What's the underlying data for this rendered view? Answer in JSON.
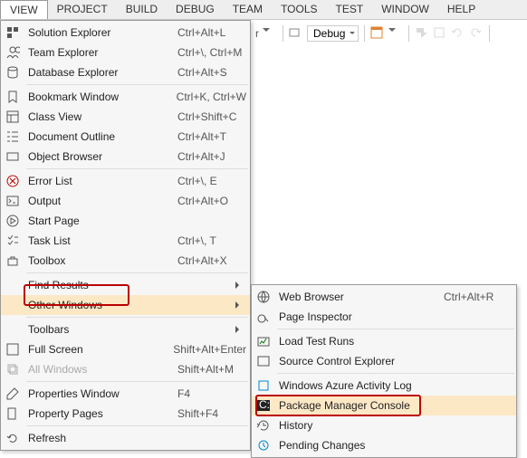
{
  "menubar": [
    "VIEW",
    "PROJECT",
    "BUILD",
    "DEBUG",
    "TEAM",
    "TOOLS",
    "TEST",
    "WINDOW",
    "HELP"
  ],
  "toolbar": {
    "suffix": "r",
    "config": "Debug"
  },
  "view_menu": [
    {
      "icon": "solution",
      "label": "Solution Explorer",
      "sc": "Ctrl+Alt+L"
    },
    {
      "icon": "team",
      "label": "Team Explorer",
      "sc": "Ctrl+\\, Ctrl+M"
    },
    {
      "icon": "db",
      "label": "Database Explorer",
      "sc": "Ctrl+Alt+S"
    },
    {
      "sep": true
    },
    {
      "icon": "bookmark",
      "label": "Bookmark Window",
      "sc": "Ctrl+K, Ctrl+W"
    },
    {
      "icon": "class",
      "label": "Class View",
      "sc": "Ctrl+Shift+C"
    },
    {
      "icon": "outline",
      "label": "Document Outline",
      "sc": "Ctrl+Alt+T"
    },
    {
      "icon": "object",
      "label": "Object Browser",
      "sc": "Ctrl+Alt+J"
    },
    {
      "sep": true
    },
    {
      "icon": "error",
      "label": "Error List",
      "sc": "Ctrl+\\, E"
    },
    {
      "icon": "output",
      "label": "Output",
      "sc": "Ctrl+Alt+O"
    },
    {
      "icon": "start",
      "label": "Start Page",
      "sc": ""
    },
    {
      "icon": "task",
      "label": "Task List",
      "sc": "Ctrl+\\, T"
    },
    {
      "icon": "toolbox",
      "label": "Toolbox",
      "sc": "Ctrl+Alt+X"
    },
    {
      "sep": true
    },
    {
      "icon": "",
      "label": "Find Results",
      "sc": "",
      "sub": true
    },
    {
      "icon": "",
      "label": "Other Windows",
      "sc": "",
      "sub": true,
      "hover": true
    },
    {
      "sep": true
    },
    {
      "icon": "",
      "label": "Toolbars",
      "sc": "",
      "sub": true
    },
    {
      "icon": "full",
      "label": "Full Screen",
      "sc": "Shift+Alt+Enter"
    },
    {
      "icon": "allwin",
      "label": "All Windows",
      "sc": "Shift+Alt+M",
      "disabled": true
    },
    {
      "sep": true
    },
    {
      "icon": "props",
      "label": "Properties Window",
      "sc": "F4"
    },
    {
      "icon": "pages",
      "label": "Property Pages",
      "sc": "Shift+F4"
    },
    {
      "sep": true
    },
    {
      "icon": "refresh",
      "label": "Refresh",
      "sc": ""
    }
  ],
  "sub_menu": [
    {
      "icon": "web",
      "label": "Web Browser",
      "sc": "Ctrl+Alt+R"
    },
    {
      "icon": "inspect",
      "label": "Page Inspector",
      "sc": ""
    },
    {
      "sep": true
    },
    {
      "icon": "load",
      "label": "Load Test Runs",
      "sc": ""
    },
    {
      "icon": "source",
      "label": "Source Control Explorer",
      "sc": ""
    },
    {
      "sep": true
    },
    {
      "icon": "azure",
      "label": "Windows Azure Activity Log",
      "sc": ""
    },
    {
      "icon": "console",
      "label": "Package Manager Console",
      "sc": "",
      "hover": true
    },
    {
      "icon": "history",
      "label": "History",
      "sc": ""
    },
    {
      "icon": "pending",
      "label": "Pending Changes",
      "sc": ""
    }
  ]
}
